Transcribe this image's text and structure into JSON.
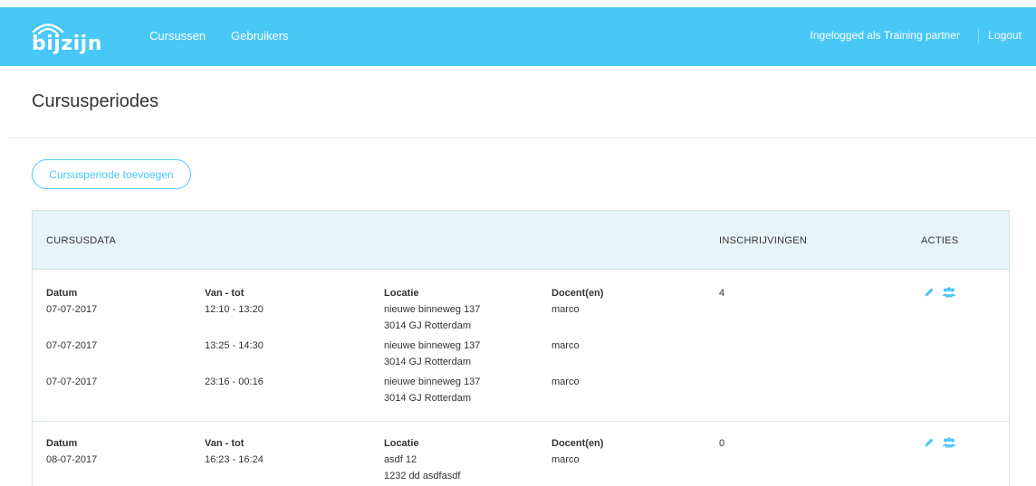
{
  "header": {
    "logo_text": "bijzijn",
    "nav": [
      {
        "label": "Cursussen"
      },
      {
        "label": "Gebruikers"
      }
    ],
    "user_label": "Ingelogged als Training partner",
    "logout_label": "Logout"
  },
  "page": {
    "title": "Cursusperiodes",
    "add_button_label": "Cursusperiode toevoegen"
  },
  "table": {
    "columns": {
      "cursusdata": "CURSUSDATA",
      "inschrijvingen": "INSCHRIJVINGEN",
      "acties": "ACTIES"
    },
    "sub_headers": {
      "datum": "Datum",
      "van_tot": "Van - tot",
      "locatie": "Locatie",
      "docenten": "Docent(en)"
    },
    "rows": [
      {
        "inschrijvingen": "4",
        "sessions": [
          {
            "datum": "07-07-2017",
            "tijd": "12:10 - 13:20",
            "adres": "nieuwe binneweg 137",
            "postcode": "3014 GJ  Rotterdam",
            "docent": "marco"
          },
          {
            "datum": "07-07-2017",
            "tijd": "13:25 - 14:30",
            "adres": "nieuwe binneweg 137",
            "postcode": "3014 GJ  Rotterdam",
            "docent": "marco"
          },
          {
            "datum": "07-07-2017",
            "tijd": "23:16 - 00:16",
            "adres": "nieuwe binneweg 137",
            "postcode": "3014 GJ  Rotterdam",
            "docent": "marco"
          }
        ]
      },
      {
        "inschrijvingen": "0",
        "sessions": [
          {
            "datum": "08-07-2017",
            "tijd": "16:23 - 16:24",
            "adres": "asdf 12",
            "postcode": "1232 dd  asdfasdf",
            "docent": "marco"
          }
        ]
      }
    ]
  },
  "icons": {
    "edit": "pencil-icon",
    "users": "users-icon"
  },
  "colors": {
    "brand": "#48c8f7",
    "table_header_bg": "#e6f5fc",
    "border": "#d6e3e8",
    "text": "#333333"
  }
}
